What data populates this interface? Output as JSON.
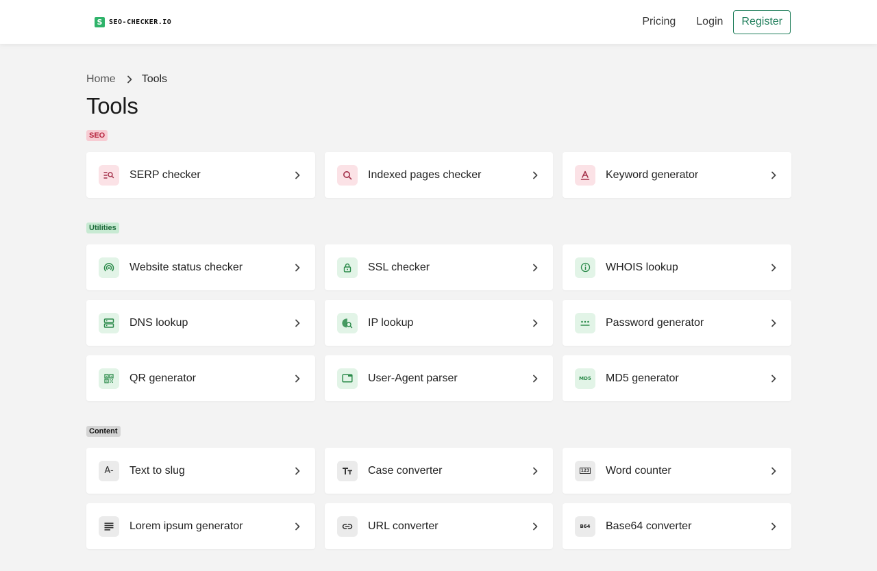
{
  "header": {
    "logo_mark": "S",
    "logo_text": "SEO-CHECKER.IO",
    "nav": {
      "pricing": "Pricing",
      "login": "Login",
      "register": "Register"
    }
  },
  "breadcrumb": {
    "home": "Home",
    "current": "Tools"
  },
  "page_title": "Tools",
  "sections": [
    {
      "badge": "SEO",
      "tools": [
        {
          "label": "SERP checker",
          "icon": "serp-icon"
        },
        {
          "label": "Indexed pages checker",
          "icon": "search-icon"
        },
        {
          "label": "Keyword generator",
          "icon": "text-a-underline-icon"
        }
      ]
    },
    {
      "badge": "Utilities",
      "tools": [
        {
          "label": "Website status checker",
          "icon": "signal-icon"
        },
        {
          "label": "SSL checker",
          "icon": "lock-icon"
        },
        {
          "label": "WHOIS lookup",
          "icon": "info-icon"
        },
        {
          "label": "DNS lookup",
          "icon": "server-icon"
        },
        {
          "label": "IP lookup",
          "icon": "globe-search-icon"
        },
        {
          "label": "Password generator",
          "icon": "password-icon"
        },
        {
          "label": "QR generator",
          "icon": "qr-code-icon"
        },
        {
          "label": "User-Agent parser",
          "icon": "browser-window-icon"
        },
        {
          "label": "MD5 generator",
          "icon": "md5-icon",
          "icon_text": "MD5"
        }
      ]
    },
    {
      "badge": "Content",
      "tools": [
        {
          "label": "Text to slug",
          "icon": "slug-icon",
          "icon_text": "A-"
        },
        {
          "label": "Case converter",
          "icon": "text-case-icon",
          "icon_text": "TT"
        },
        {
          "label": "Word counter",
          "icon": "counter-icon",
          "icon_text": "123"
        },
        {
          "label": "Lorem ipsum generator",
          "icon": "paragraph-icon"
        },
        {
          "label": "URL converter",
          "icon": "link-icon"
        },
        {
          "label": "Base64 converter",
          "icon": "base64-icon",
          "icon_text": "B64"
        }
      ]
    }
  ]
}
